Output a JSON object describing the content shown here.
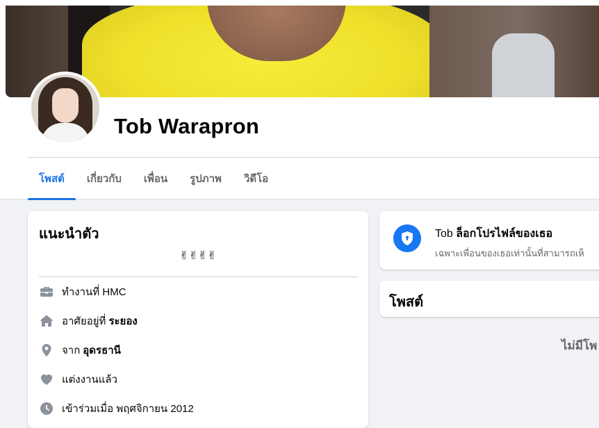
{
  "profile": {
    "name": "Tob Warapron"
  },
  "tabs": [
    {
      "label": "โพสต์",
      "active": true
    },
    {
      "label": "เกี่ยวกับ",
      "active": false
    },
    {
      "label": "เพื่อน",
      "active": false
    },
    {
      "label": "รูปภาพ",
      "active": false
    },
    {
      "label": "วิดีโอ",
      "active": false
    }
  ],
  "intro": {
    "title": "แนะนำตัว",
    "bio": "✌✌✌✌",
    "items": [
      {
        "icon": "briefcase-icon",
        "text": "ทำงานที่ HMC",
        "bold": ""
      },
      {
        "icon": "home-icon",
        "text": "อาศัยอยู่ที่",
        "bold": "ระยอง"
      },
      {
        "icon": "location-pin-icon",
        "text": "จาก",
        "bold": "อุดรธานี"
      },
      {
        "icon": "heart-icon",
        "text": "แต่งงานแล้ว",
        "bold": ""
      },
      {
        "icon": "clock-icon",
        "text": "เข้าร่วมเมื่อ พฤศจิกายน 2012",
        "bold": ""
      }
    ]
  },
  "locked": {
    "name": "Tob",
    "title_rest": "ล็อกโปรไฟล์ของเธอ",
    "subtitle": "เฉพาะเพื่อนของเธอเท่านั้นที่สามารถเห็"
  },
  "posts": {
    "title": "โพสต์",
    "empty": "ไม่มีโพ"
  },
  "colors": {
    "accent": "#1b74e4",
    "icon_gray": "#8c939d",
    "secondary_text": "#65676b"
  }
}
